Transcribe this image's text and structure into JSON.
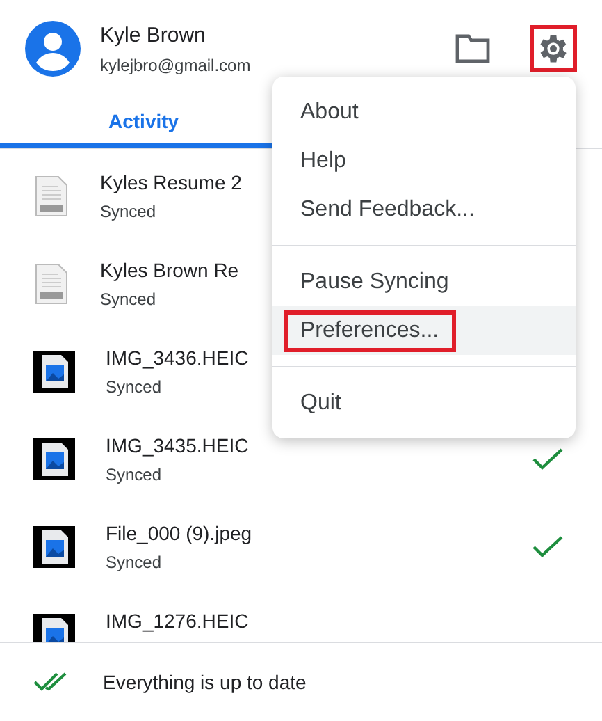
{
  "account": {
    "name": "Kyle Brown",
    "email": "kylejbro@gmail.com"
  },
  "toolbar": {
    "settings_highlighted": true
  },
  "tabs": [
    {
      "label": "Activity",
      "selected": true
    }
  ],
  "files": [
    {
      "kind": "docx",
      "name": "Kyles Resume 2",
      "status": "Synced",
      "checked": false
    },
    {
      "kind": "docx",
      "name": "Kyles Brown Re",
      "status": "Synced",
      "checked": false
    },
    {
      "kind": "image",
      "name": "IMG_3436.HEIC",
      "status": "Synced",
      "checked": false
    },
    {
      "kind": "image",
      "name": "IMG_3435.HEIC",
      "status": "Synced",
      "checked": true
    },
    {
      "kind": "image",
      "name": "File_000 (9).jpeg",
      "status": "Synced",
      "checked": true
    },
    {
      "kind": "image",
      "name": "IMG_1276.HEIC",
      "checked": false
    }
  ],
  "menu": {
    "groups": [
      [
        {
          "label": "About",
          "hovered": false,
          "highlighted": false
        },
        {
          "label": "Help",
          "hovered": false,
          "highlighted": false
        },
        {
          "label": "Send Feedback...",
          "hovered": false,
          "highlighted": false
        }
      ],
      [
        {
          "label": "Pause Syncing",
          "hovered": false,
          "highlighted": false
        },
        {
          "label": "Preferences...",
          "hovered": true,
          "highlighted": true
        }
      ],
      [
        {
          "label": "Quit",
          "hovered": false,
          "highlighted": false
        }
      ]
    ]
  },
  "status_bar": {
    "text": "Everything is up to date"
  }
}
